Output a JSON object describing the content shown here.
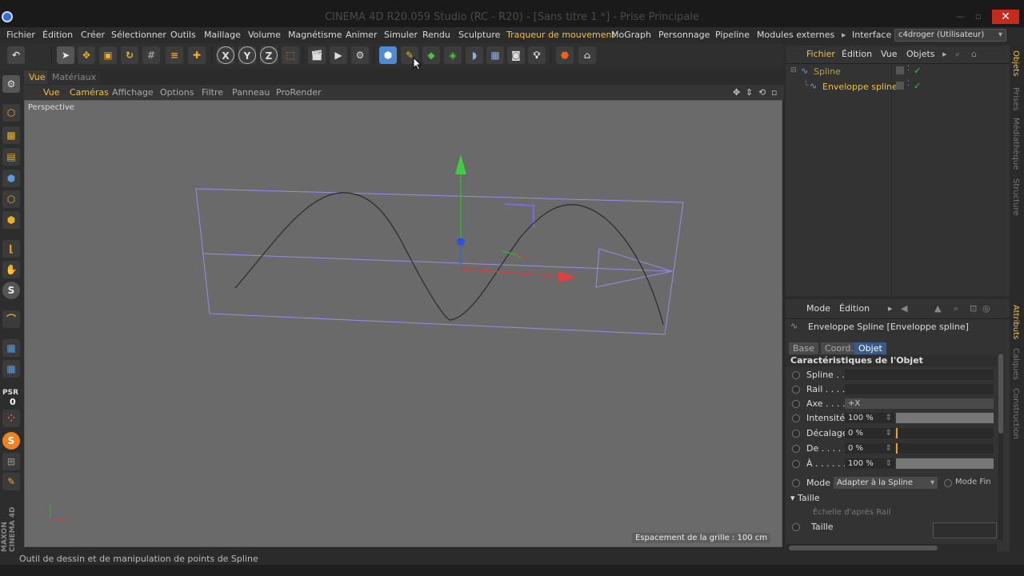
{
  "window": {
    "title": "CINEMA 4D R20.059 Studio (RC - R20) - [Sans titre 1 *] - Prise Principale"
  },
  "menubar": {
    "items": [
      "Fichier",
      "Édition",
      "Créer",
      "Sélectionner",
      "Outils",
      "Maillage",
      "Volume",
      "Magnétisme",
      "Animer",
      "Simuler",
      "Rendu",
      "Sculpture",
      "Traqueur de mouvement",
      "MoGraph",
      "Personnage",
      "Pipeline",
      "Modules externes"
    ],
    "interface_label": "Interface :",
    "interface_value": "c4droger (Utilisateur)"
  },
  "viewport_tabs": {
    "vue": "Vue",
    "materiaux": "Matériaux"
  },
  "viewport_menu": [
    "Vue",
    "Caméras",
    "Affichage",
    "Options",
    "Filtre",
    "Panneau",
    "ProRender"
  ],
  "viewport": {
    "label": "Perspective",
    "grid_spacing": "Espacement de la grille : 100 cm"
  },
  "left_palette": {
    "psr_label": "PSR",
    "psr_value": "0",
    "brand": "MAXON CINEMA 4D"
  },
  "toolbar": {
    "axis_x": "X",
    "axis_y": "Y",
    "axis_z": "Z"
  },
  "object_manager": {
    "menu": [
      "Fichier",
      "Édition",
      "Vue",
      "Objets"
    ],
    "objects": [
      {
        "name": "Spline",
        "indent": 0
      },
      {
        "name": "Enveloppe spline",
        "indent": 1
      }
    ]
  },
  "attribute_manager": {
    "menu": [
      "Mode",
      "Édition"
    ],
    "object_title": "Enveloppe Spline [Enveloppe spline]",
    "tabs": [
      "Base",
      "Coord.",
      "Objet"
    ],
    "active_tab": "Objet",
    "section_title": "Caractéristiques de l'Objet",
    "rows": [
      {
        "label": "Spline . .",
        "kind": "link",
        "value": ""
      },
      {
        "label": "Rail . . . .",
        "kind": "link",
        "value": ""
      },
      {
        "label": "Axe . . . .",
        "kind": "select",
        "value": "+X"
      },
      {
        "label": "Intensité",
        "kind": "slider",
        "value": "100 %",
        "fraction": 1.0
      },
      {
        "label": "Décalage",
        "kind": "slider",
        "value": "0 %",
        "fraction": 0.0
      },
      {
        "label": "De . . . . .",
        "kind": "slider",
        "value": "0 %",
        "fraction": 0.0
      },
      {
        "label": "À . . . . . .",
        "kind": "slider",
        "value": "100 %",
        "fraction": 1.0
      }
    ],
    "mode_label": "Mode",
    "mode_value": "Adapter à la Spline",
    "mode_fin": "Mode Fin",
    "taille_group": "Taille",
    "echelle": "Échelle d'après Rail",
    "taille_label": "Taille"
  },
  "right_tabs": [
    "Objets",
    "Prises",
    "Médiathèque",
    "Structure",
    "Attributs",
    "Calques",
    "Construction"
  ],
  "status_bar": {
    "text": "Outil de dessin et de manipulation de points de Spline"
  },
  "colors": {
    "accent": "#f0c040",
    "active_tab": "#3a5a8c",
    "close": "#c42b1c"
  }
}
